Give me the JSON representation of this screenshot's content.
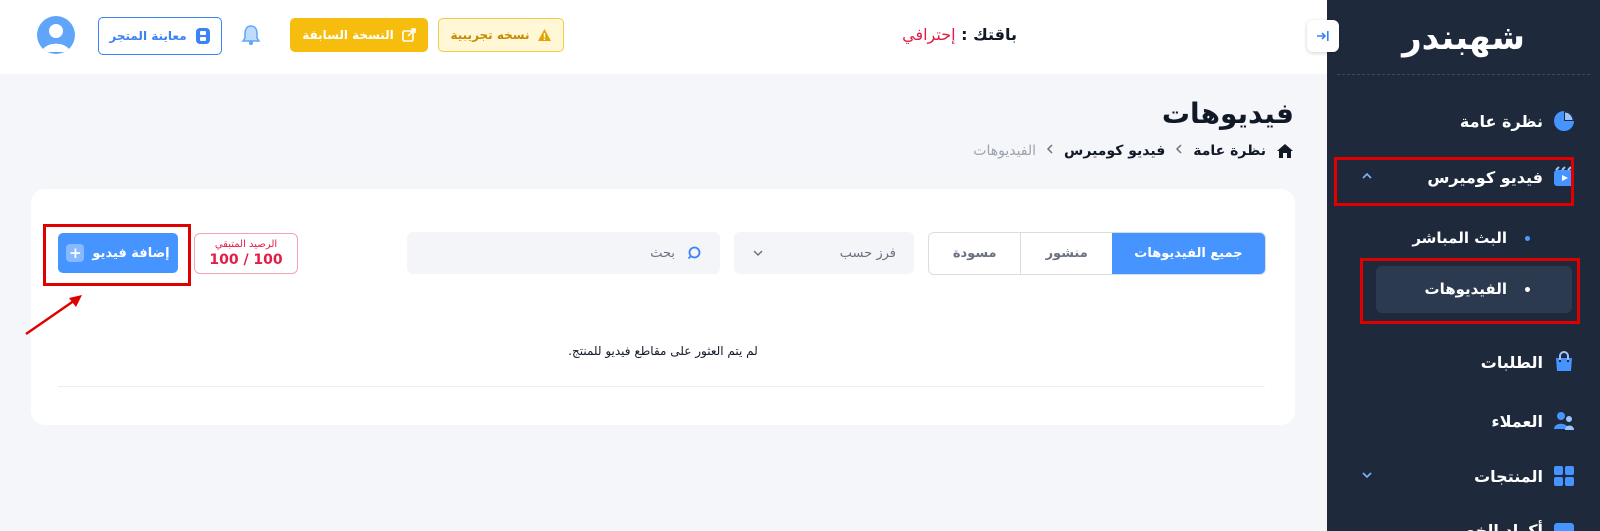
{
  "brand": {
    "logo_text": "شهبندر"
  },
  "sidebar": {
    "items": [
      {
        "label": "نظرة عامة",
        "icon": "pie-chart-icon"
      },
      {
        "label": "فيديو كوميرس",
        "icon": "video-commerce-icon",
        "expanded": true
      },
      {
        "label": "الطلبات",
        "icon": "shopping-bag-icon"
      },
      {
        "label": "العملاء",
        "icon": "users-icon"
      },
      {
        "label": "المنتجات",
        "icon": "grid-icon"
      },
      {
        "label": "أكواد الخصم",
        "icon": "discount-icon"
      }
    ],
    "subitems": [
      {
        "label": "البث المباشر"
      },
      {
        "label": "الفيديوهات",
        "active": true
      }
    ]
  },
  "header": {
    "plan_label": "باقتك :",
    "plan_value": "إحترافي",
    "trial_label": "نسخه تجريبية",
    "previous_version_label": "النسخة السابقة",
    "preview_store_label": "معاينة المتجر"
  },
  "page": {
    "title": "فيديوهات",
    "breadcrumb": [
      "نظرة عامة",
      "فيديو كوميرس",
      "الفيديوهات"
    ]
  },
  "videos": {
    "tabs": [
      {
        "label": "جميع الفيديوهات",
        "active": true
      },
      {
        "label": "منشور"
      },
      {
        "label": "مسودة"
      }
    ],
    "sort_label": "فرز حسب",
    "search_placeholder": "بحث",
    "balance_label": "الرصيد المتبقي",
    "balance_value": "100 / 100",
    "add_button_label": "إضافة فيديو",
    "empty_message": "لم يتم العثور على مقاطع فيديو للمنتج."
  },
  "colors": {
    "sidebar_bg": "#1e2a3b",
    "accent_blue": "#4594ff",
    "warning_yellow": "#f6bd0f",
    "danger_red": "#e11d48",
    "annotation_red": "#e00000"
  }
}
